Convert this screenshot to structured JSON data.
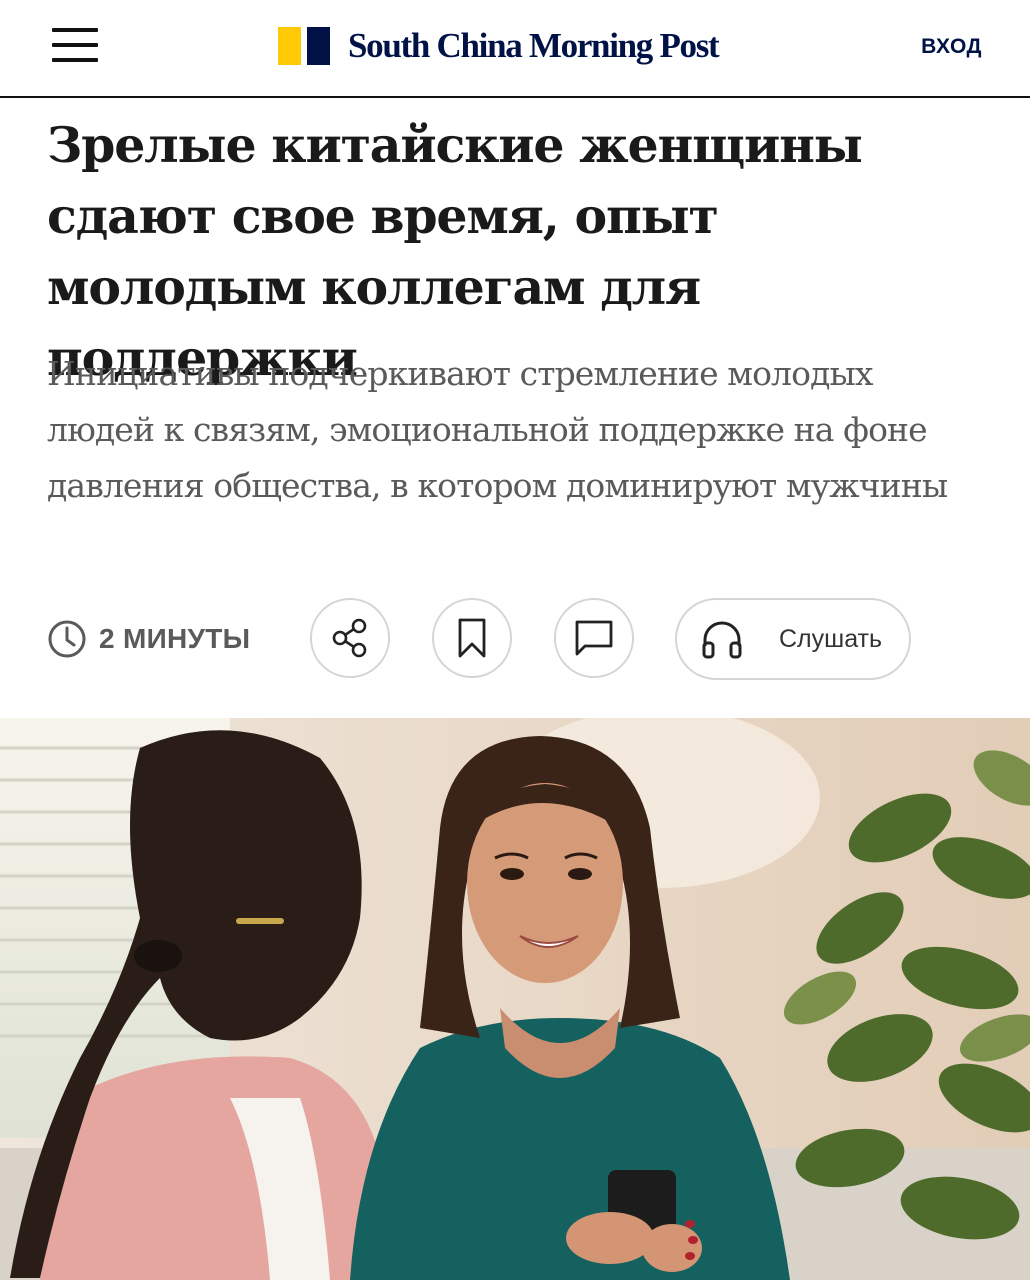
{
  "header": {
    "brand": "South China Morning Post",
    "login_label": "ВХОД",
    "brand_colors": {
      "yellow": "#ffca05",
      "navy": "#001246"
    }
  },
  "article": {
    "headline": "Зрелые китайские женщины сдают свое время, опыт молодым коллегам для поддержки",
    "subheadline": "Инициативы подчеркивают стремление молодых людей к связям, эмоциональной поддержке на фоне давления общества, в котором доминируют мужчины",
    "read_time": "2 МИНУТЫ",
    "actions": {
      "share_icon": "share-icon",
      "bookmark_icon": "bookmark-icon",
      "comment_icon": "comment-icon",
      "listen_icon": "headphones-icon",
      "listen_label": "Слушать"
    }
  }
}
